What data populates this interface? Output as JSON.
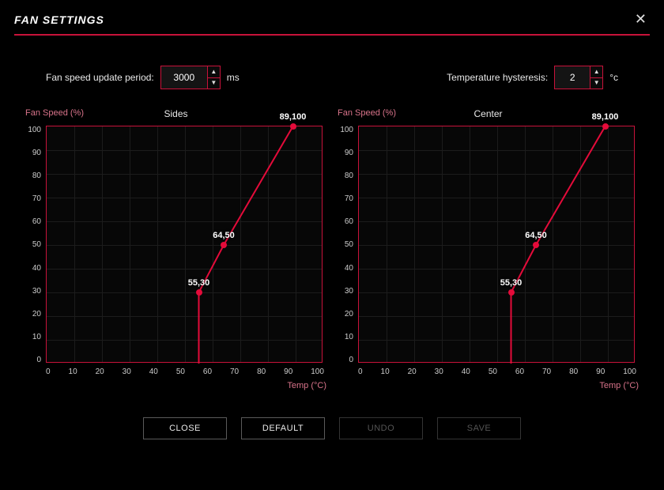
{
  "title": "FAN SETTINGS",
  "controls": {
    "update_period": {
      "label": "Fan speed update period:",
      "value": "3000",
      "unit": "ms"
    },
    "hysteresis": {
      "label": "Temperature hysteresis:",
      "value": "2",
      "unit": "°c"
    }
  },
  "chart_data": [
    {
      "type": "line",
      "title": "Sides",
      "xlabel": "Temp (°C)",
      "ylabel": "Fan Speed (%)",
      "xlim": [
        0,
        100
      ],
      "ylim": [
        0,
        100
      ],
      "xticks": [
        "0",
        "10",
        "20",
        "30",
        "40",
        "50",
        "60",
        "70",
        "80",
        "90",
        "100"
      ],
      "yticks": [
        "100",
        "90",
        "80",
        "70",
        "60",
        "50",
        "40",
        "30",
        "20",
        "10",
        "0"
      ],
      "points": [
        {
          "x": 55,
          "y": 30,
          "label": "55,30"
        },
        {
          "x": 64,
          "y": 50,
          "label": "64,50"
        },
        {
          "x": 89,
          "y": 100,
          "label": "89,100"
        }
      ]
    },
    {
      "type": "line",
      "title": "Center",
      "xlabel": "Temp (°C)",
      "ylabel": "Fan Speed (%)",
      "xlim": [
        0,
        100
      ],
      "ylim": [
        0,
        100
      ],
      "xticks": [
        "0",
        "10",
        "20",
        "30",
        "40",
        "50",
        "60",
        "70",
        "80",
        "90",
        "100"
      ],
      "yticks": [
        "100",
        "90",
        "80",
        "70",
        "60",
        "50",
        "40",
        "30",
        "20",
        "10",
        "0"
      ],
      "points": [
        {
          "x": 55,
          "y": 30,
          "label": "55,30"
        },
        {
          "x": 64,
          "y": 50,
          "label": "64,50"
        },
        {
          "x": 89,
          "y": 100,
          "label": "89,100"
        }
      ]
    }
  ],
  "buttons": {
    "close": "CLOSE",
    "default": "DEFAULT",
    "undo": "UNDO",
    "save": "SAVE"
  },
  "colors": {
    "accent": "#c8123a",
    "curve": "#e40b3a"
  }
}
